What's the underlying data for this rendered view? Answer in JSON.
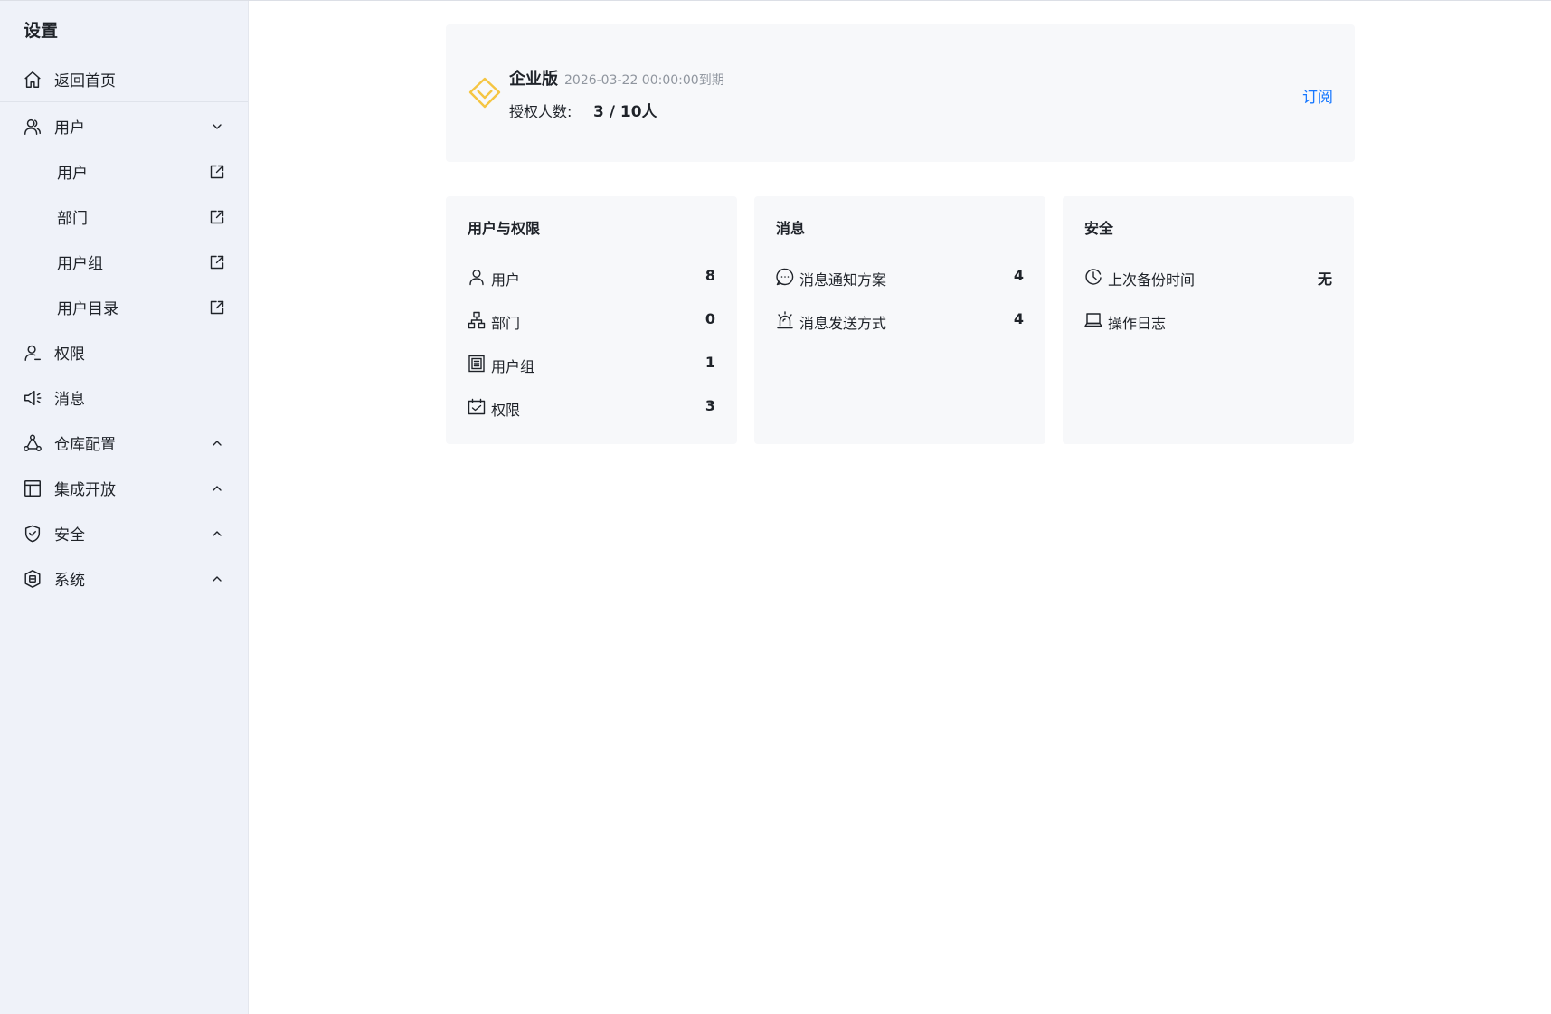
{
  "sidebar": {
    "title": "设置",
    "home": "返回首页",
    "items": [
      {
        "label": "用户",
        "expanded": true,
        "children": [
          "用户",
          "部门",
          "用户组",
          "用户目录"
        ]
      },
      {
        "label": "权限"
      },
      {
        "label": "消息"
      },
      {
        "label": "仓库配置"
      },
      {
        "label": "集成开放"
      },
      {
        "label": "安全"
      },
      {
        "label": "系统"
      }
    ]
  },
  "license": {
    "edition": "企业版",
    "expire": "2026-03-22 00:00:00到期",
    "seats_label": "授权人数:",
    "seats_value": "3 / 10人",
    "subscribe": "订阅",
    "icon": "diamond-icon",
    "icon_color": "#f5c542"
  },
  "cards": [
    {
      "title": "用户与权限",
      "rows": [
        {
          "label": "用户",
          "value": "8"
        },
        {
          "label": "部门",
          "value": "0"
        },
        {
          "label": "用户组",
          "value": "1"
        },
        {
          "label": "权限",
          "value": "3"
        }
      ]
    },
    {
      "title": "消息",
      "rows": [
        {
          "label": "消息通知方案",
          "value": "4"
        },
        {
          "label": "消息发送方式",
          "value": "4"
        }
      ]
    },
    {
      "title": "安全",
      "rows": [
        {
          "label": "上次备份时间",
          "value": "无"
        },
        {
          "label": "操作日志"
        }
      ]
    }
  ],
  "colors": {
    "sidebar_bg": "#eff2f9",
    "card_bg": "#f7f8fa",
    "accent": "#1677ff"
  }
}
